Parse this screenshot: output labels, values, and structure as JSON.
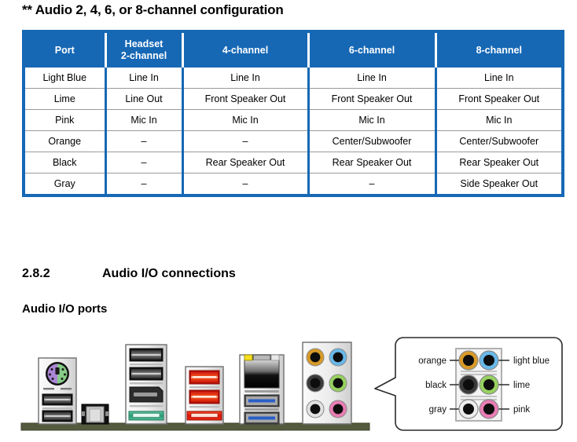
{
  "note_title": "** Audio 2, 4, 6, or 8-channel configuration",
  "table": {
    "headers": [
      "Port",
      "Headset\n2-channel",
      "4-channel",
      "6-channel",
      "8-channel"
    ],
    "header_cells": [
      {
        "line1": "Port",
        "line2": ""
      },
      {
        "line1": "Headset",
        "line2": "2-channel"
      },
      {
        "line1": "4-channel",
        "line2": ""
      },
      {
        "line1": "6-channel",
        "line2": ""
      },
      {
        "line1": "8-channel",
        "line2": ""
      }
    ],
    "rows": [
      {
        "port": "Light Blue",
        "ch2": "Line In",
        "ch4": "Line In",
        "ch6": "Line In",
        "ch8": "Line In"
      },
      {
        "port": "Lime",
        "ch2": "Line Out",
        "ch4": "Front Speaker Out",
        "ch6": "Front Speaker Out",
        "ch8": "Front Speaker Out"
      },
      {
        "port": "Pink",
        "ch2": "Mic In",
        "ch4": "Mic In",
        "ch6": "Mic In",
        "ch8": "Mic In"
      },
      {
        "port": "Orange",
        "ch2": "–",
        "ch4": "–",
        "ch6": "Center/Subwoofer",
        "ch8": "Center/Subwoofer"
      },
      {
        "port": "Black",
        "ch2": "–",
        "ch4": "Rear Speaker Out",
        "ch6": "Rear Speaker Out",
        "ch8": "Rear Speaker Out"
      },
      {
        "port": "Gray",
        "ch2": "–",
        "ch4": "–",
        "ch6": "–",
        "ch8": "Side Speaker Out"
      }
    ]
  },
  "section": {
    "number": "2.8.2",
    "title": "Audio I/O connections",
    "subtitle": "Audio I/O ports"
  },
  "callout": {
    "labels_left": [
      "orange",
      "black",
      "gray"
    ],
    "labels_right": [
      "light blue",
      "lime",
      "pink"
    ]
  },
  "jack_colors": {
    "orange": "#d99a27",
    "light_blue": "#68b9ea",
    "black": "#3a3a3a",
    "lime": "#97d25f",
    "gray": "#e2e2e2",
    "pink": "#ea7cb4"
  },
  "theme": {
    "table_blue": "#1668b5",
    "row_rule": "#9a9a9a",
    "chassis": "#545a3e",
    "usb3_blue": "#2a5fc8",
    "esata_red": "#e52219",
    "sata_green": "#3fae86",
    "lan_led_yellow": "#f5e01a",
    "ps2_purple": "#ab86d6",
    "ps2_green": "#86cc86"
  }
}
